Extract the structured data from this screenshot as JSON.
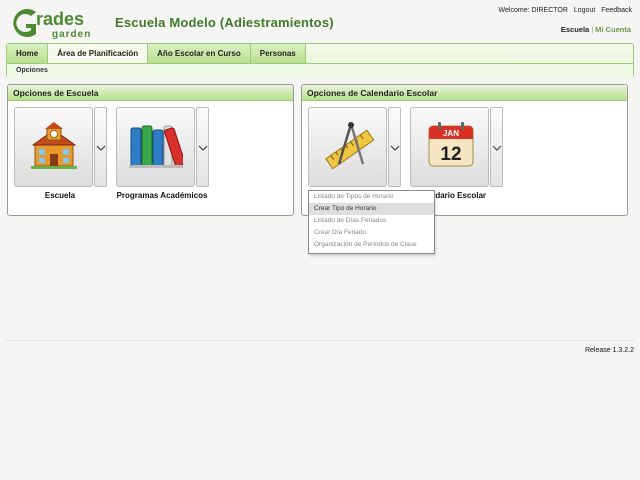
{
  "brand": {
    "logo_text_top": "rades",
    "logo_letter": "G",
    "logo_text_bottom": "garden",
    "accent": "#4b8a32"
  },
  "header": {
    "school_name": "Escuela Modelo (Adiestramientos)",
    "welcome": "Welcome: DIRECTOR",
    "logout": "Logout",
    "feedback": "Feedback",
    "context_active": "Escuela",
    "context_separator": "|",
    "context_other": "Mi Cuenta"
  },
  "nav": {
    "tabs": [
      {
        "label": "Home",
        "active": false
      },
      {
        "label": "Área de Planificación",
        "active": true
      },
      {
        "label": "Año Escolar en Curso",
        "active": false
      },
      {
        "label": "Personas",
        "active": false
      }
    ],
    "subnav": "Opciones"
  },
  "panels": {
    "school": {
      "title": "Opciones de Escuela",
      "tiles": [
        {
          "label": "Escuela",
          "icon": "school-building-icon"
        },
        {
          "label": "Programas Académicos",
          "icon": "books-icon"
        }
      ]
    },
    "calendar": {
      "title": "Opciones de Calendario Escolar",
      "tiles": [
        {
          "label": "",
          "icon": "ruler-compass-icon"
        },
        {
          "label": "endario Escolar",
          "icon": "calendar-icon",
          "calendar_month": "JAN",
          "calendar_day": "12"
        }
      ]
    }
  },
  "dropdown": {
    "items": [
      {
        "label": "Listado de Tipos de Horario",
        "highlighted": false
      },
      {
        "label": "Crear Tipo de Horario",
        "highlighted": true
      },
      {
        "label": "Listado de Días Feriados",
        "highlighted": false
      },
      {
        "label": "Crear Día Feriado",
        "highlighted": false
      },
      {
        "label": "Organización de Períodos de Clase",
        "highlighted": false
      }
    ]
  },
  "footer": {
    "release": "Release 1.3.2.2"
  }
}
